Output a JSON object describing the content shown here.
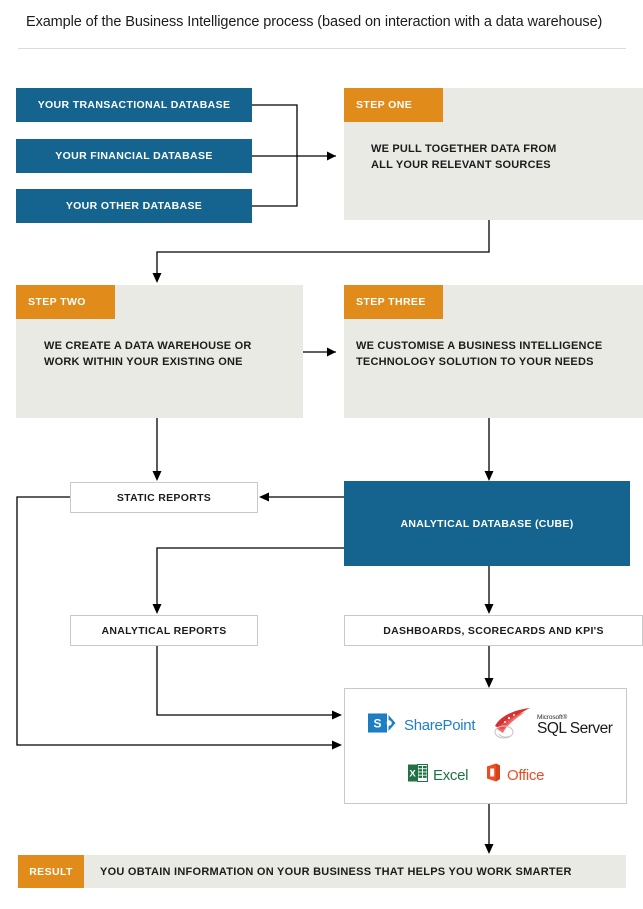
{
  "header": {
    "title": "Example of the Business Intelligence process (based on interaction with a data warehouse)"
  },
  "sources": [
    {
      "label": "YOUR TRANSACTIONAL DATABASE"
    },
    {
      "label": "YOUR FINANCIAL DATABASE"
    },
    {
      "label": "YOUR OTHER DATABASE"
    }
  ],
  "steps": [
    {
      "tag": "STEP ONE",
      "body_line1": "WE PULL TOGETHER DATA FROM",
      "body_line2": "ALL YOUR RELEVANT SOURCES"
    },
    {
      "tag": "STEP TWO",
      "body_line1": "WE CREATE A DATA WAREHOUSE OR",
      "body_line2": "WORK WITHIN YOUR EXISTING ONE"
    },
    {
      "tag": "STEP THREE",
      "body_line1": "WE CUSTOMISE A BUSINESS INTELLIGENCE",
      "body_line2": "TECHNOLOGY SOLUTION TO YOUR NEEDS"
    }
  ],
  "outputs": {
    "static_reports": "STATIC REPORTS",
    "analytical_reports": "ANALYTICAL REPORTS",
    "dashboards": "DASHBOARDS, SCORECARDS AND KPI'S",
    "cube": "ANALYTICAL DATABASE (CUBE)"
  },
  "technologies": [
    {
      "name": "SharePoint",
      "icon": "sharepoint-logo"
    },
    {
      "name": "SQL Server",
      "brand": "Microsoft®",
      "icon": "sql-server-logo"
    },
    {
      "name": "Excel",
      "icon": "excel-logo"
    },
    {
      "name": "Office",
      "icon": "office-logo"
    }
  ],
  "result": {
    "tag": "RESULT",
    "text": "YOU OBTAIN INFORMATION ON YOUR BUSINESS THAT HELPS YOU WORK SMARTER"
  },
  "colors": {
    "blue": "#15648f",
    "orange": "#e08b1a",
    "panel_gray": "#eaeae4",
    "border_gray": "#c9c9c9",
    "sharepoint_blue": "#1f7fc4",
    "sql_red": "#d8302f",
    "excel_green": "#207245",
    "office_orange": "#eb4d24"
  }
}
